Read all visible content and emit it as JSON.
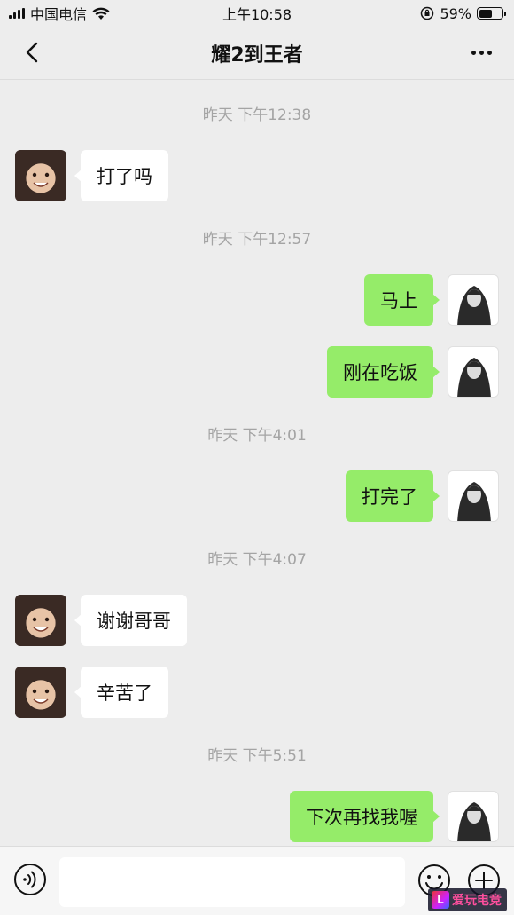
{
  "status_bar": {
    "carrier": "中国电信",
    "time": "上午10:58",
    "battery_percent": "59%",
    "battery_level": 0.59,
    "icons": [
      "signal-icon",
      "wifi-icon",
      "orientation-lock-icon",
      "battery-icon"
    ]
  },
  "nav": {
    "title": "耀2到王者",
    "icons": [
      "back-icon",
      "more-icon"
    ]
  },
  "chat": {
    "items": [
      {
        "kind": "timestamp",
        "text": "昨天 下午12:38"
      },
      {
        "kind": "message",
        "side": "left",
        "text": "打了吗"
      },
      {
        "kind": "timestamp",
        "text": "昨天 下午12:57"
      },
      {
        "kind": "message",
        "side": "right",
        "text": "马上"
      },
      {
        "kind": "message",
        "side": "right",
        "text": "刚在吃饭"
      },
      {
        "kind": "timestamp",
        "text": "昨天 下午4:01"
      },
      {
        "kind": "message",
        "side": "right",
        "text": "打完了"
      },
      {
        "kind": "timestamp",
        "text": "昨天 下午4:07"
      },
      {
        "kind": "message",
        "side": "left",
        "text": "谢谢哥哥"
      },
      {
        "kind": "message",
        "side": "left",
        "text": "辛苦了"
      },
      {
        "kind": "timestamp",
        "text": "昨天 下午5:51"
      },
      {
        "kind": "message",
        "side": "right",
        "text": "下次再找我喔"
      }
    ]
  },
  "input_bar": {
    "text_value": "",
    "icons": [
      "voice-icon",
      "emoji-icon",
      "plus-icon"
    ]
  },
  "watermark": {
    "logo_glyph": "L",
    "text": "爱玩电竞"
  },
  "colors": {
    "background": "#ededed",
    "bubble_self": "#95ec69",
    "bubble_other": "#ffffff",
    "timestamp": "#a4a4a4"
  }
}
